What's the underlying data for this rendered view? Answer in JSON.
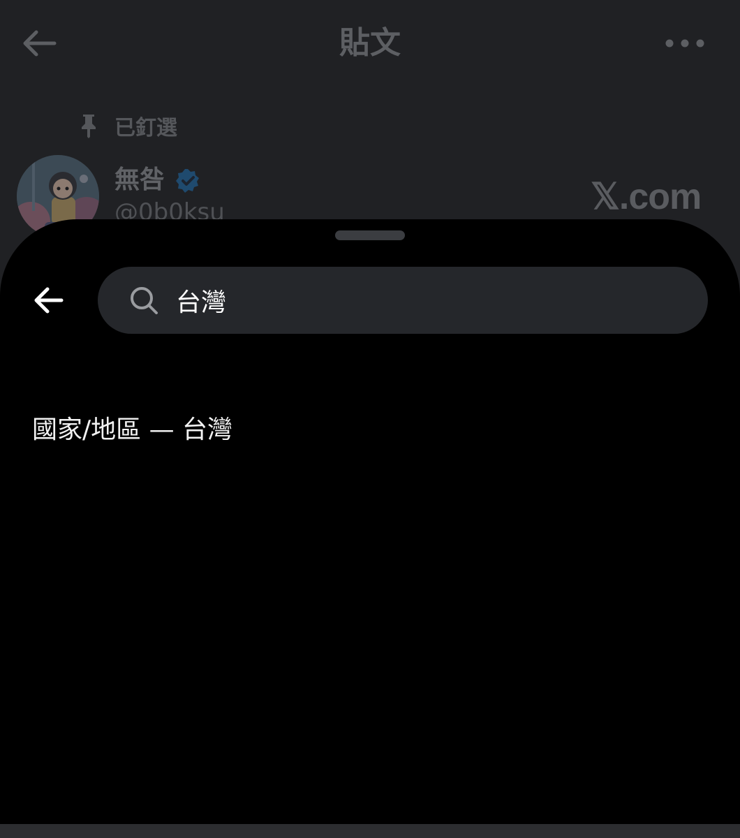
{
  "header": {
    "title": "貼文",
    "back_icon": "arrow-left-icon",
    "more_icon": "more-horizontal-icon"
  },
  "pinned": {
    "label": "已釘選"
  },
  "post": {
    "author_name": "無咎",
    "author_handle": "@0b0ksu",
    "verified": true,
    "watermark": "𝕏.com"
  },
  "sheet": {
    "back_icon": "arrow-left-icon",
    "search": {
      "value": "台灣",
      "placeholder": ""
    },
    "results": [
      {
        "label": "國家/地區 — 台灣"
      }
    ]
  },
  "colors": {
    "sheet_background": "#000000",
    "search_background": "#25272b",
    "verified_blue": "#1d9bf0"
  }
}
